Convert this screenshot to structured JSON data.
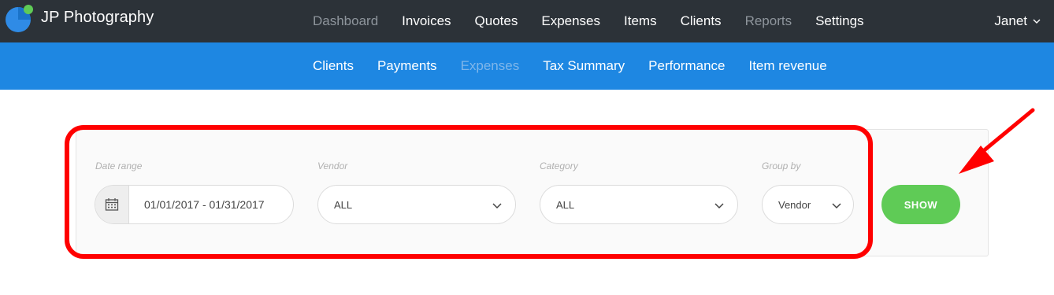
{
  "app": {
    "brand": "JP Photography",
    "logo_icon": "brand-logo-icon"
  },
  "main_nav": [
    {
      "label": "Dashboard",
      "active": false
    },
    {
      "label": "Invoices",
      "active": true
    },
    {
      "label": "Quotes",
      "active": true
    },
    {
      "label": "Expenses",
      "active": true
    },
    {
      "label": "Items",
      "active": true
    },
    {
      "label": "Clients",
      "active": true
    },
    {
      "label": "Reports",
      "active": false
    },
    {
      "label": "Settings",
      "active": true
    }
  ],
  "user": {
    "name": "Janet",
    "dropdown_icon": "chevron-down-icon"
  },
  "sub_nav": [
    {
      "label": "Clients",
      "current": false
    },
    {
      "label": "Payments",
      "current": false
    },
    {
      "label": "Expenses",
      "current": true
    },
    {
      "label": "Tax Summary",
      "current": false
    },
    {
      "label": "Performance",
      "current": false
    },
    {
      "label": "Item revenue",
      "current": false
    }
  ],
  "filters": {
    "date_range": {
      "label": "Date range",
      "value": "01/01/2017 - 01/31/2017",
      "icon": "calendar-icon"
    },
    "vendor": {
      "label": "Vendor",
      "value": "ALL"
    },
    "category": {
      "label": "Category",
      "value": "ALL"
    },
    "group_by": {
      "label": "Group by",
      "value": "Vendor"
    },
    "show_button": "SHOW"
  },
  "colors": {
    "topbar": "#2c3238",
    "subbar": "#1e87e2",
    "show_button": "#5fcb56",
    "highlight": "#ff0000"
  }
}
